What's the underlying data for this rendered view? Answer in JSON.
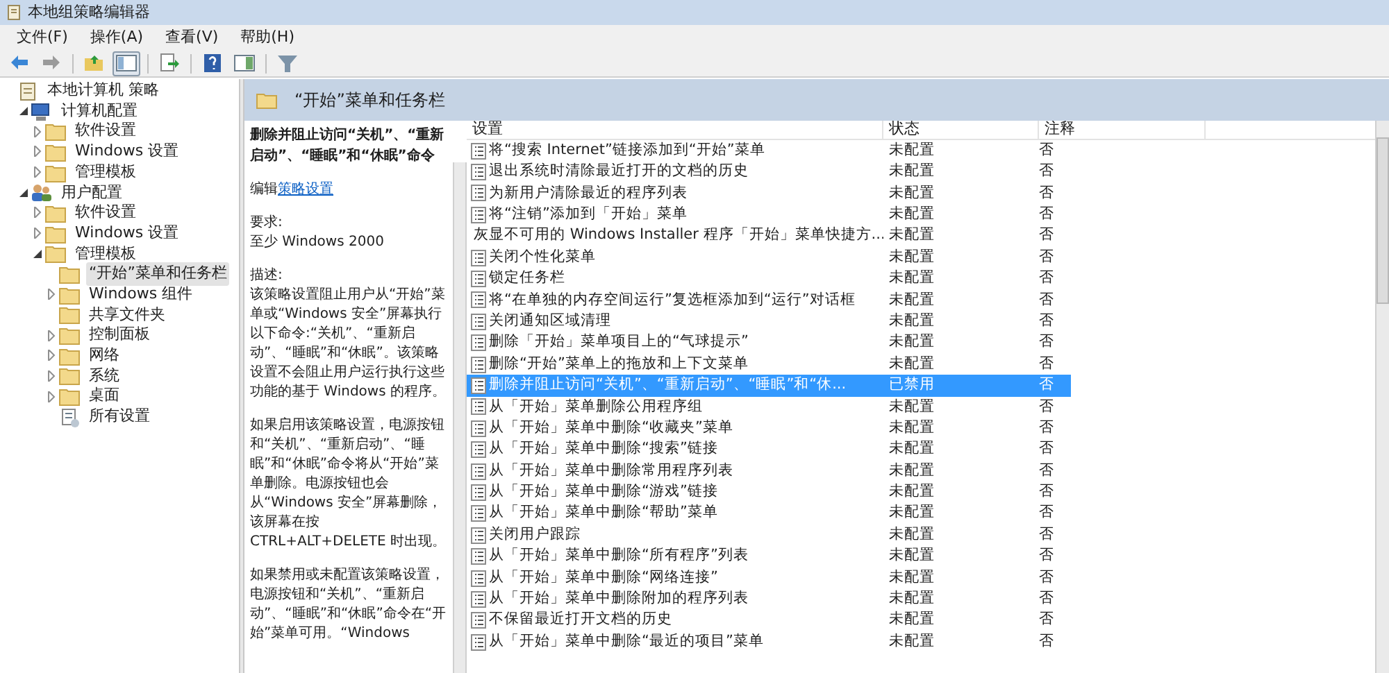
{
  "window": {
    "title": "本地组策略编辑器"
  },
  "menu": [
    "文件(F)",
    "操作(A)",
    "查看(V)",
    "帮助(H)"
  ],
  "toolbar": [
    {
      "kind": "back",
      "pressed": false
    },
    {
      "kind": "forward",
      "pressed": false
    },
    {
      "kind": "sep"
    },
    {
      "kind": "up",
      "pressed": false
    },
    {
      "kind": "tree",
      "pressed": true
    },
    {
      "kind": "sep"
    },
    {
      "kind": "export",
      "pressed": false
    },
    {
      "kind": "sep"
    },
    {
      "kind": "help",
      "pressed": false
    },
    {
      "kind": "panel",
      "pressed": false
    },
    {
      "kind": "sep"
    },
    {
      "kind": "filter",
      "pressed": false
    }
  ],
  "tree": [
    {
      "label": "本地计算机 策略",
      "kind": "policy",
      "selected": false,
      "children": [
        {
          "label": "计算机配置",
          "kind": "computer",
          "expanded": true,
          "selected": false,
          "children": [
            {
              "label": "软件设置",
              "kind": "folder",
              "expanded": false,
              "selected": false
            },
            {
              "label": "Windows 设置",
              "kind": "folder",
              "expanded": false,
              "selected": false
            },
            {
              "label": "管理模板",
              "kind": "folder",
              "expanded": false,
              "selected": false
            }
          ]
        },
        {
          "label": "用户配置",
          "kind": "users",
          "expanded": true,
          "selected": false,
          "children": [
            {
              "label": "软件设置",
              "kind": "folder",
              "expanded": false,
              "selected": false
            },
            {
              "label": "Windows 设置",
              "kind": "folder",
              "expanded": false,
              "selected": false
            },
            {
              "label": "管理模板",
              "kind": "folder",
              "expanded": true,
              "selected": false,
              "children": [
                {
                  "label": "“开始”菜单和任务栏",
                  "kind": "folder",
                  "selected": true
                },
                {
                  "label": "Windows 组件",
                  "kind": "folder",
                  "expanded": false,
                  "selected": false
                },
                {
                  "label": "共享文件夹",
                  "kind": "folder",
                  "selected": false
                },
                {
                  "label": "控制面板",
                  "kind": "folder",
                  "expanded": false,
                  "selected": false
                },
                {
                  "label": "网络",
                  "kind": "folder",
                  "expanded": false,
                  "selected": false
                },
                {
                  "label": "系统",
                  "kind": "folder",
                  "expanded": false,
                  "selected": false
                },
                {
                  "label": "桌面",
                  "kind": "folder",
                  "expanded": false,
                  "selected": false
                },
                {
                  "label": "所有设置",
                  "kind": "settings",
                  "selected": false
                }
              ]
            }
          ]
        }
      ]
    }
  ],
  "header": {
    "title": "“开始”菜单和任务栏"
  },
  "description": {
    "title": "删除并阻止访问“关机”、“重新启动”、“睡眠”和“休眠”命令",
    "edit_prefix": "编辑",
    "edit_link": "策略设置",
    "paragraphs": [
      "要求:\n至少 Windows 2000",
      "描述:\n该策略设置阻止用户从“开始”菜单或“Windows 安全”屏幕执行以下命令:“关机”、“重新启动”、“睡眠”和“休眠”。该策略设置不会阻止用户运行执行这些功能的基于 Windows 的程序。",
      "如果启用该策略设置，电源按钮和“关机”、“重新启动”、“睡眠”和“休眠”命令将从“开始”菜单删除。电源按钮也会从“Windows 安全”屏幕删除，该屏幕在按 CTRL+ALT+DELETE 时出现。",
      "如果禁用或未配置该策略设置，电源按钮和“关机”、“重新启动”、“睡眠”和“休眠”命令在“开始”菜单可用。“Windows"
    ]
  },
  "table": {
    "columns": [
      "设置",
      "状态",
      "注释"
    ],
    "rows": [
      {
        "setting": "将“搜索 Internet”链接添加到“开始”菜单",
        "state": "未配置",
        "comment": "否",
        "selected": false
      },
      {
        "setting": "退出系统时清除最近打开的文档的历史",
        "state": "未配置",
        "comment": "否",
        "selected": false
      },
      {
        "setting": "为新用户清除最近的程序列表",
        "state": "未配置",
        "comment": "否",
        "selected": false
      },
      {
        "setting": "将“注销”添加到「开始」菜单",
        "state": "未配置",
        "comment": "否",
        "selected": false
      },
      {
        "setting": "灰显不可用的 Windows Installer 程序「开始」菜单快捷方...",
        "state": "未配置",
        "comment": "否",
        "selected": false
      },
      {
        "setting": "关闭个性化菜单",
        "state": "未配置",
        "comment": "否",
        "selected": false
      },
      {
        "setting": "锁定任务栏",
        "state": "未配置",
        "comment": "否",
        "selected": false
      },
      {
        "setting": "将“在单独的内存空间运行”复选框添加到“运行”对话框",
        "state": "未配置",
        "comment": "否",
        "selected": false
      },
      {
        "setting": "关闭通知区域清理",
        "state": "未配置",
        "comment": "否",
        "selected": false
      },
      {
        "setting": "删除「开始」菜单项目上的“气球提示”",
        "state": "未配置",
        "comment": "否",
        "selected": false
      },
      {
        "setting": "删除“开始”菜单上的拖放和上下文菜单",
        "state": "未配置",
        "comment": "否",
        "selected": false
      },
      {
        "setting": "删除并阻止访问“关机”、“重新启动”、“睡眠”和“休...",
        "state": "已禁用",
        "comment": "否",
        "selected": true
      },
      {
        "setting": "从「开始」菜单删除公用程序组",
        "state": "未配置",
        "comment": "否",
        "selected": false
      },
      {
        "setting": "从「开始」菜单中删除“收藏夹”菜单",
        "state": "未配置",
        "comment": "否",
        "selected": false
      },
      {
        "setting": "从「开始」菜单中删除“搜索”链接",
        "state": "未配置",
        "comment": "否",
        "selected": false
      },
      {
        "setting": "从「开始」菜单中删除常用程序列表",
        "state": "未配置",
        "comment": "否",
        "selected": false
      },
      {
        "setting": "从「开始」菜单中删除“游戏”链接",
        "state": "未配置",
        "comment": "否",
        "selected": false
      },
      {
        "setting": "从「开始」菜单中删除“帮助”菜单",
        "state": "未配置",
        "comment": "否",
        "selected": false
      },
      {
        "setting": "关闭用户跟踪",
        "state": "未配置",
        "comment": "否",
        "selected": false
      },
      {
        "setting": "从「开始」菜单中删除“所有程序”列表",
        "state": "未配置",
        "comment": "否",
        "selected": false
      },
      {
        "setting": "从「开始」菜单中删除“网络连接”",
        "state": "未配置",
        "comment": "否",
        "selected": false
      },
      {
        "setting": "从「开始」菜单中删除附加的程序列表",
        "state": "未配置",
        "comment": "否",
        "selected": false
      },
      {
        "setting": "不保留最近打开文档的历史",
        "state": "未配置",
        "comment": "否",
        "selected": false
      },
      {
        "setting": "从「开始」菜单中删除“最近的项目”菜单",
        "state": "未配置",
        "comment": "否",
        "selected": false
      }
    ]
  }
}
